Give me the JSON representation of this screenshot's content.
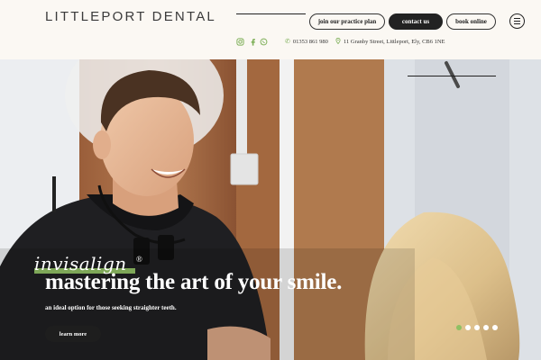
{
  "header": {
    "logo": "LITTLEPORT DENTAL",
    "buttons": {
      "practice_plan": "join our practice plan",
      "contact": "contact us",
      "book": "book online"
    },
    "phone": "01353 861 980",
    "address": "11 Granby Street, Littleport, Ely, CB6 1NE",
    "social_icons": [
      "instagram-icon",
      "facebook-icon",
      "whatsapp-icon"
    ],
    "menu_icon": "hamburger-menu-icon"
  },
  "hero": {
    "brand": "invisalign",
    "brand_mark": "®",
    "headline": "mastering the art of your smile.",
    "subline": "an ideal option for those seeking straighter teeth.",
    "cta": "learn more",
    "slides": {
      "count": 5,
      "active": 1
    }
  },
  "colors": {
    "accent": "#8fc063",
    "dark": "#222222",
    "background": "#fbf8f3"
  }
}
